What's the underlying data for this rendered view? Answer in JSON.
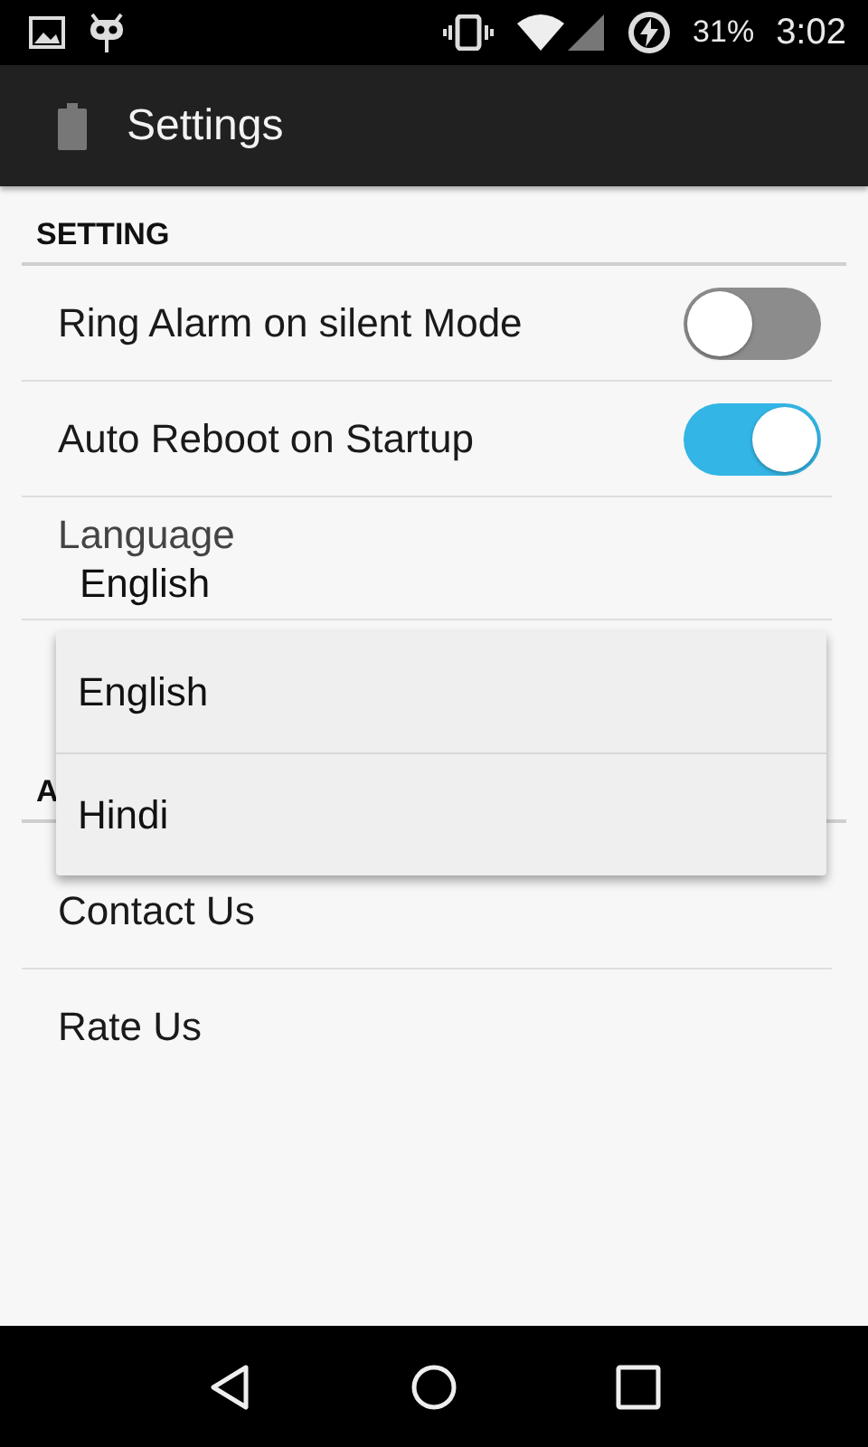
{
  "status_bar": {
    "battery": "31%",
    "time": "3:02"
  },
  "app_bar": {
    "title": "Settings"
  },
  "sections": [
    {
      "header": "SETTING",
      "items": [
        {
          "kind": "toggle",
          "label": "Ring Alarm on silent Mode",
          "on": false
        },
        {
          "kind": "toggle",
          "label": "Auto Reboot on Startup",
          "on": true
        },
        {
          "kind": "choice",
          "label": "Language",
          "value": "English"
        }
      ]
    },
    {
      "header": "A",
      "items": [
        {
          "kind": "link",
          "label": "Contact Us"
        },
        {
          "kind": "link",
          "label": "Rate Us"
        }
      ]
    }
  ],
  "dropdown": {
    "options": [
      {
        "label": "English"
      },
      {
        "label": "Hindi"
      }
    ]
  }
}
